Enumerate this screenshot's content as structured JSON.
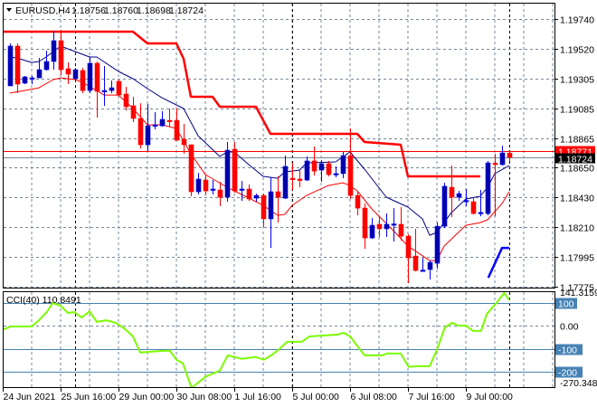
{
  "header": {
    "symbol": "EURUSD,H4",
    "open": "1.18756",
    "high": "1.18760",
    "low": "1.18698",
    "close": "1.18724"
  },
  "colors": {
    "bull": "#0000a8",
    "bear": "#ff0000",
    "ma_fast": "#000080",
    "ma_slow": "#ff0000",
    "stop_line": "#ff0000",
    "blue_line": "#0000ff",
    "cci": "#7cfc00",
    "cci_levels": "#4682b4",
    "grid": "#778899",
    "ask_line": "#ff0000",
    "bid_line": "#778899"
  },
  "price_axis": {
    "min": 1.17775,
    "max": 1.1974,
    "ticks": [
      "1.19740",
      "1.19520",
      "1.19305",
      "1.19085",
      "1.18865",
      "1.18650",
      "1.18430",
      "1.18210",
      "1.17995",
      "1.17775"
    ],
    "ask_label": "1.18771",
    "ask": 1.18771,
    "bid_label": "1.18724",
    "bid": 1.18724
  },
  "time_axis": {
    "labels": [
      {
        "bar": -1,
        "text": "24 Jun 2021"
      },
      {
        "bar": 7,
        "text": "25 Jun 16:00"
      },
      {
        "bar": 15,
        "text": "29 Jun 00:00"
      },
      {
        "bar": 23,
        "text": "30 Jun 08:00"
      },
      {
        "bar": 31,
        "text": "1 Jul 16:00"
      },
      {
        "bar": 39,
        "text": "5 Jul 00:00"
      },
      {
        "bar": 47,
        "text": "6 Jul 08:00"
      },
      {
        "bar": 55,
        "text": "7 Jul 16:00"
      },
      {
        "bar": 63,
        "text": "9 Jul 00:00"
      }
    ],
    "vertical_markers": [
      9,
      39,
      69
    ]
  },
  "candles": [
    [
      1.19249,
      1.19561,
      1.19249,
      1.19541
    ],
    [
      1.19541,
      1.19561,
      1.19196,
      1.19262
    ],
    [
      1.19269,
      1.19322,
      1.19262,
      1.19315
    ],
    [
      1.19302,
      1.19322,
      1.19262,
      1.19308
    ],
    [
      1.19308,
      1.19454,
      1.19308,
      1.19368
    ],
    [
      1.19368,
      1.19508,
      1.19362,
      1.19428
    ],
    [
      1.19428,
      1.19654,
      1.19368,
      1.19581
    ],
    [
      1.19581,
      1.1966,
      1.19328,
      1.19368
    ],
    [
      1.19375,
      1.19421,
      1.19262,
      1.19335
    ],
    [
      1.19302,
      1.19381,
      1.19295,
      1.19368
    ],
    [
      1.19362,
      1.19381,
      1.19196,
      1.19215
    ],
    [
      1.19215,
      1.19461,
      1.19196,
      1.19415
    ],
    [
      1.19415,
      1.19428,
      1.19016,
      1.19209
    ],
    [
      1.19209,
      1.19395,
      1.19103,
      1.19215
    ],
    [
      1.19215,
      1.19288,
      1.19196,
      1.19235
    ],
    [
      1.19282,
      1.19295,
      1.19182,
      1.19182
    ],
    [
      1.19189,
      1.19242,
      1.19069,
      1.19096
    ],
    [
      1.19103,
      1.19169,
      1.18983,
      1.1901
    ],
    [
      1.1901,
      1.19122,
      1.1879,
      1.18817
    ],
    [
      1.18817,
      1.19116,
      1.18771,
      1.18956
    ],
    [
      1.18956,
      1.19056,
      1.1893,
      1.18963
    ],
    [
      1.18956,
      1.19063,
      1.1895,
      1.19003
    ],
    [
      1.18996,
      1.19083,
      1.1895,
      1.1899
    ],
    [
      1.18996,
      1.19083,
      1.1885,
      1.1885
    ],
    [
      1.18857,
      1.1897,
      1.18751,
      1.18817
    ],
    [
      1.18817,
      1.18817,
      1.18439,
      1.18472
    ],
    [
      1.18472,
      1.18611,
      1.18452,
      1.18565
    ],
    [
      1.18558,
      1.18598,
      1.18452,
      1.18478
    ],
    [
      1.18485,
      1.18558,
      1.18452,
      1.18492
    ],
    [
      1.18485,
      1.18545,
      1.18366,
      1.18432
    ],
    [
      1.18432,
      1.18837,
      1.18399,
      1.18777
    ],
    [
      1.18784,
      1.18837,
      1.18465,
      1.18478
    ],
    [
      1.18485,
      1.18551,
      1.18405,
      1.18492
    ],
    [
      1.18492,
      1.18525,
      1.18405,
      1.18419
    ],
    [
      1.18425,
      1.18458,
      1.18399,
      1.18445
    ],
    [
      1.18445,
      1.18458,
      1.18213,
      1.18273
    ],
    [
      1.18273,
      1.18578,
      1.1806,
      1.18472
    ],
    [
      1.18472,
      1.18585,
      1.18246,
      1.18432
    ],
    [
      1.18425,
      1.18737,
      1.18419,
      1.18658
    ],
    [
      1.18571,
      1.18684,
      1.18485,
      1.18565
    ],
    [
      1.18565,
      1.18631,
      1.18505,
      1.18558
    ],
    [
      1.18558,
      1.18731,
      1.18551,
      1.18698
    ],
    [
      1.18698,
      1.18804,
      1.18591,
      1.18624
    ],
    [
      1.18631,
      1.18705,
      1.18545,
      1.18678
    ],
    [
      1.18678,
      1.18698,
      1.18585,
      1.18598
    ],
    [
      1.18598,
      1.18658,
      1.18578,
      1.18605
    ],
    [
      1.18605,
      1.18764,
      1.18571,
      1.18737
    ],
    [
      1.18737,
      1.18937,
      1.18419,
      1.18445
    ],
    [
      1.18445,
      1.18472,
      1.18299,
      1.18352
    ],
    [
      1.18352,
      1.18385,
      1.18053,
      1.18133
    ],
    [
      1.18133,
      1.18279,
      1.18126,
      1.18226
    ],
    [
      1.18233,
      1.18286,
      1.1814,
      1.182
    ],
    [
      1.182,
      1.18312,
      1.1814,
      1.18233
    ],
    [
      1.1823,
      1.18352,
      1.18107,
      1.18236
    ],
    [
      1.18233,
      1.18359,
      1.18113,
      1.18146
    ],
    [
      1.18146,
      1.1816,
      1.17801,
      1.17987
    ],
    [
      1.18,
      1.182,
      1.17887,
      1.17894
    ],
    [
      1.1789,
      1.17987,
      1.17887,
      1.17897
    ],
    [
      1.17901,
      1.17967,
      1.17828,
      1.17954
    ],
    [
      1.17947,
      1.18246,
      1.17907,
      1.18219
    ],
    [
      1.18219,
      1.18538,
      1.18206,
      1.18512
    ],
    [
      1.18505,
      1.18664,
      1.18286,
      1.18432
    ],
    [
      1.18432,
      1.18478,
      1.18405,
      1.18458
    ],
    [
      1.18402,
      1.18492,
      1.18366,
      1.18408
    ],
    [
      1.18399,
      1.18425,
      1.18306,
      1.18312
    ],
    [
      1.18315,
      1.18485,
      1.18292,
      1.1832
    ],
    [
      1.18312,
      1.18698,
      1.18299,
      1.18684
    ],
    [
      1.18681,
      1.18751,
      1.18292,
      1.18675
    ],
    [
      1.18671,
      1.1881,
      1.18664,
      1.18757
    ],
    [
      1.18756,
      1.1876,
      1.18698,
      1.18724
    ]
  ],
  "ma_fast": [
    [
      0,
      1.19461
    ],
    [
      1,
      1.19454
    ],
    [
      3,
      1.19421
    ],
    [
      4,
      1.19428
    ],
    [
      5,
      1.19461
    ],
    [
      7,
      1.19541
    ],
    [
      9,
      1.19501
    ],
    [
      11,
      1.19461
    ],
    [
      12,
      1.19461
    ],
    [
      15,
      1.19355
    ],
    [
      17,
      1.19302
    ],
    [
      19,
      1.19229
    ],
    [
      21,
      1.19162
    ],
    [
      24,
      1.19083
    ],
    [
      26,
      1.18883
    ],
    [
      29,
      1.18731
    ],
    [
      30,
      1.18764
    ],
    [
      31,
      1.18764
    ],
    [
      33,
      1.18671
    ],
    [
      35,
      1.18585
    ],
    [
      37,
      1.18571
    ],
    [
      38,
      1.18618
    ],
    [
      40,
      1.18631
    ],
    [
      41,
      1.18684
    ],
    [
      45,
      1.18691
    ],
    [
      47,
      1.18764
    ],
    [
      49,
      1.18638
    ],
    [
      52,
      1.18432
    ],
    [
      55,
      1.18359
    ],
    [
      57,
      1.18273
    ],
    [
      58,
      1.18153
    ],
    [
      59,
      1.18173
    ],
    [
      61,
      1.18319
    ],
    [
      63,
      1.18419
    ],
    [
      65,
      1.18439
    ],
    [
      66,
      1.18505
    ],
    [
      67,
      1.18605
    ],
    [
      69,
      1.18664
    ]
  ],
  "ma_slow": [
    [
      0,
      1.19196
    ],
    [
      2,
      1.19215
    ],
    [
      4,
      1.19235
    ],
    [
      6,
      1.19295
    ],
    [
      7,
      1.19308
    ],
    [
      9,
      1.19295
    ],
    [
      10,
      1.19275
    ],
    [
      12,
      1.19215
    ],
    [
      13,
      1.19182
    ],
    [
      15,
      1.19182
    ],
    [
      17,
      1.19083
    ],
    [
      19,
      1.18963
    ],
    [
      21,
      1.18963
    ],
    [
      23,
      1.18937
    ],
    [
      25,
      1.18751
    ],
    [
      27,
      1.18598
    ],
    [
      30,
      1.18505
    ],
    [
      32,
      1.18452
    ],
    [
      35,
      1.18372
    ],
    [
      37,
      1.18299
    ],
    [
      38,
      1.18306
    ],
    [
      39,
      1.18372
    ],
    [
      41,
      1.18445
    ],
    [
      44,
      1.18518
    ],
    [
      46,
      1.18538
    ],
    [
      47,
      1.18518
    ],
    [
      48,
      1.18478
    ],
    [
      50,
      1.18346
    ],
    [
      53,
      1.18186
    ],
    [
      55,
      1.18073
    ],
    [
      58,
      1.17967
    ],
    [
      59,
      1.17967
    ],
    [
      60,
      1.18073
    ],
    [
      63,
      1.18226
    ],
    [
      65,
      1.18246
    ],
    [
      66,
      1.18266
    ],
    [
      68,
      1.18385
    ],
    [
      69,
      1.18472
    ]
  ],
  "stop_line": [
    [
      -1,
      1.19647
    ],
    [
      17,
      1.19647
    ],
    [
      19,
      1.19561
    ],
    [
      23,
      1.19561
    ],
    [
      24,
      1.19448
    ],
    [
      25,
      1.19169
    ],
    [
      28,
      1.19169
    ],
    [
      29,
      1.19096
    ],
    [
      34,
      1.19096
    ],
    [
      36,
      1.18897
    ],
    [
      48,
      1.18897
    ],
    [
      49,
      1.18837
    ],
    [
      54,
      1.18817
    ],
    [
      55,
      1.18585
    ],
    [
      65,
      1.18585
    ]
  ],
  "blue_line": [
    [
      66.1,
      1.17841
    ],
    [
      68,
      1.1806
    ],
    [
      69,
      1.1806
    ]
  ],
  "cci": {
    "label": "CCI(40) 110.8491",
    "max_label": "141.3159",
    "min_label": "-270.3482",
    "zero_label": "0.00",
    "levels": [
      {
        "value": 100,
        "text": "100"
      },
      {
        "value": -100,
        "text": "-100"
      },
      {
        "value": -200,
        "text": "-200"
      }
    ],
    "values": [
      [
        -1.4,
        -23
      ],
      [
        0.1,
        -4
      ],
      [
        3,
        -4
      ],
      [
        4,
        23
      ],
      [
        5.1,
        59
      ],
      [
        5.9,
        98
      ],
      [
        7,
        86
      ],
      [
        8,
        55
      ],
      [
        8.9,
        59
      ],
      [
        9.9,
        35
      ],
      [
        11,
        62
      ],
      [
        12,
        16
      ],
      [
        13.3,
        23
      ],
      [
        14.6,
        12
      ],
      [
        15.8,
        -12
      ],
      [
        17,
        -47
      ],
      [
        18,
        -117
      ],
      [
        21.4,
        -109
      ],
      [
        22.1,
        -109
      ],
      [
        23,
        -148
      ],
      [
        23.9,
        -164
      ],
      [
        25.1,
        -270.3
      ],
      [
        27,
        -222
      ],
      [
        29,
        -195
      ],
      [
        30.1,
        -129
      ],
      [
        32,
        -144
      ],
      [
        33.9,
        -136
      ],
      [
        35.1,
        -148
      ],
      [
        36.1,
        -129
      ],
      [
        37.1,
        -105
      ],
      [
        38.3,
        -70
      ],
      [
        40.3,
        -70
      ],
      [
        41.4,
        -47
      ],
      [
        45.3,
        -39
      ],
      [
        46.1,
        -31
      ],
      [
        47,
        -47
      ],
      [
        49,
        -129
      ],
      [
        51.4,
        -129
      ],
      [
        52.1,
        -121
      ],
      [
        54,
        -121
      ],
      [
        55.1,
        -179
      ],
      [
        56.1,
        -176
      ],
      [
        58,
        -176
      ],
      [
        59,
        -105
      ],
      [
        60.1,
        -8
      ],
      [
        61.1,
        12
      ],
      [
        62,
        0
      ],
      [
        63,
        0
      ],
      [
        64,
        -23
      ],
      [
        65.1,
        -23
      ],
      [
        65.9,
        51
      ],
      [
        67,
        90
      ],
      [
        68.3,
        141.3
      ],
      [
        69,
        110.8
      ]
    ]
  }
}
